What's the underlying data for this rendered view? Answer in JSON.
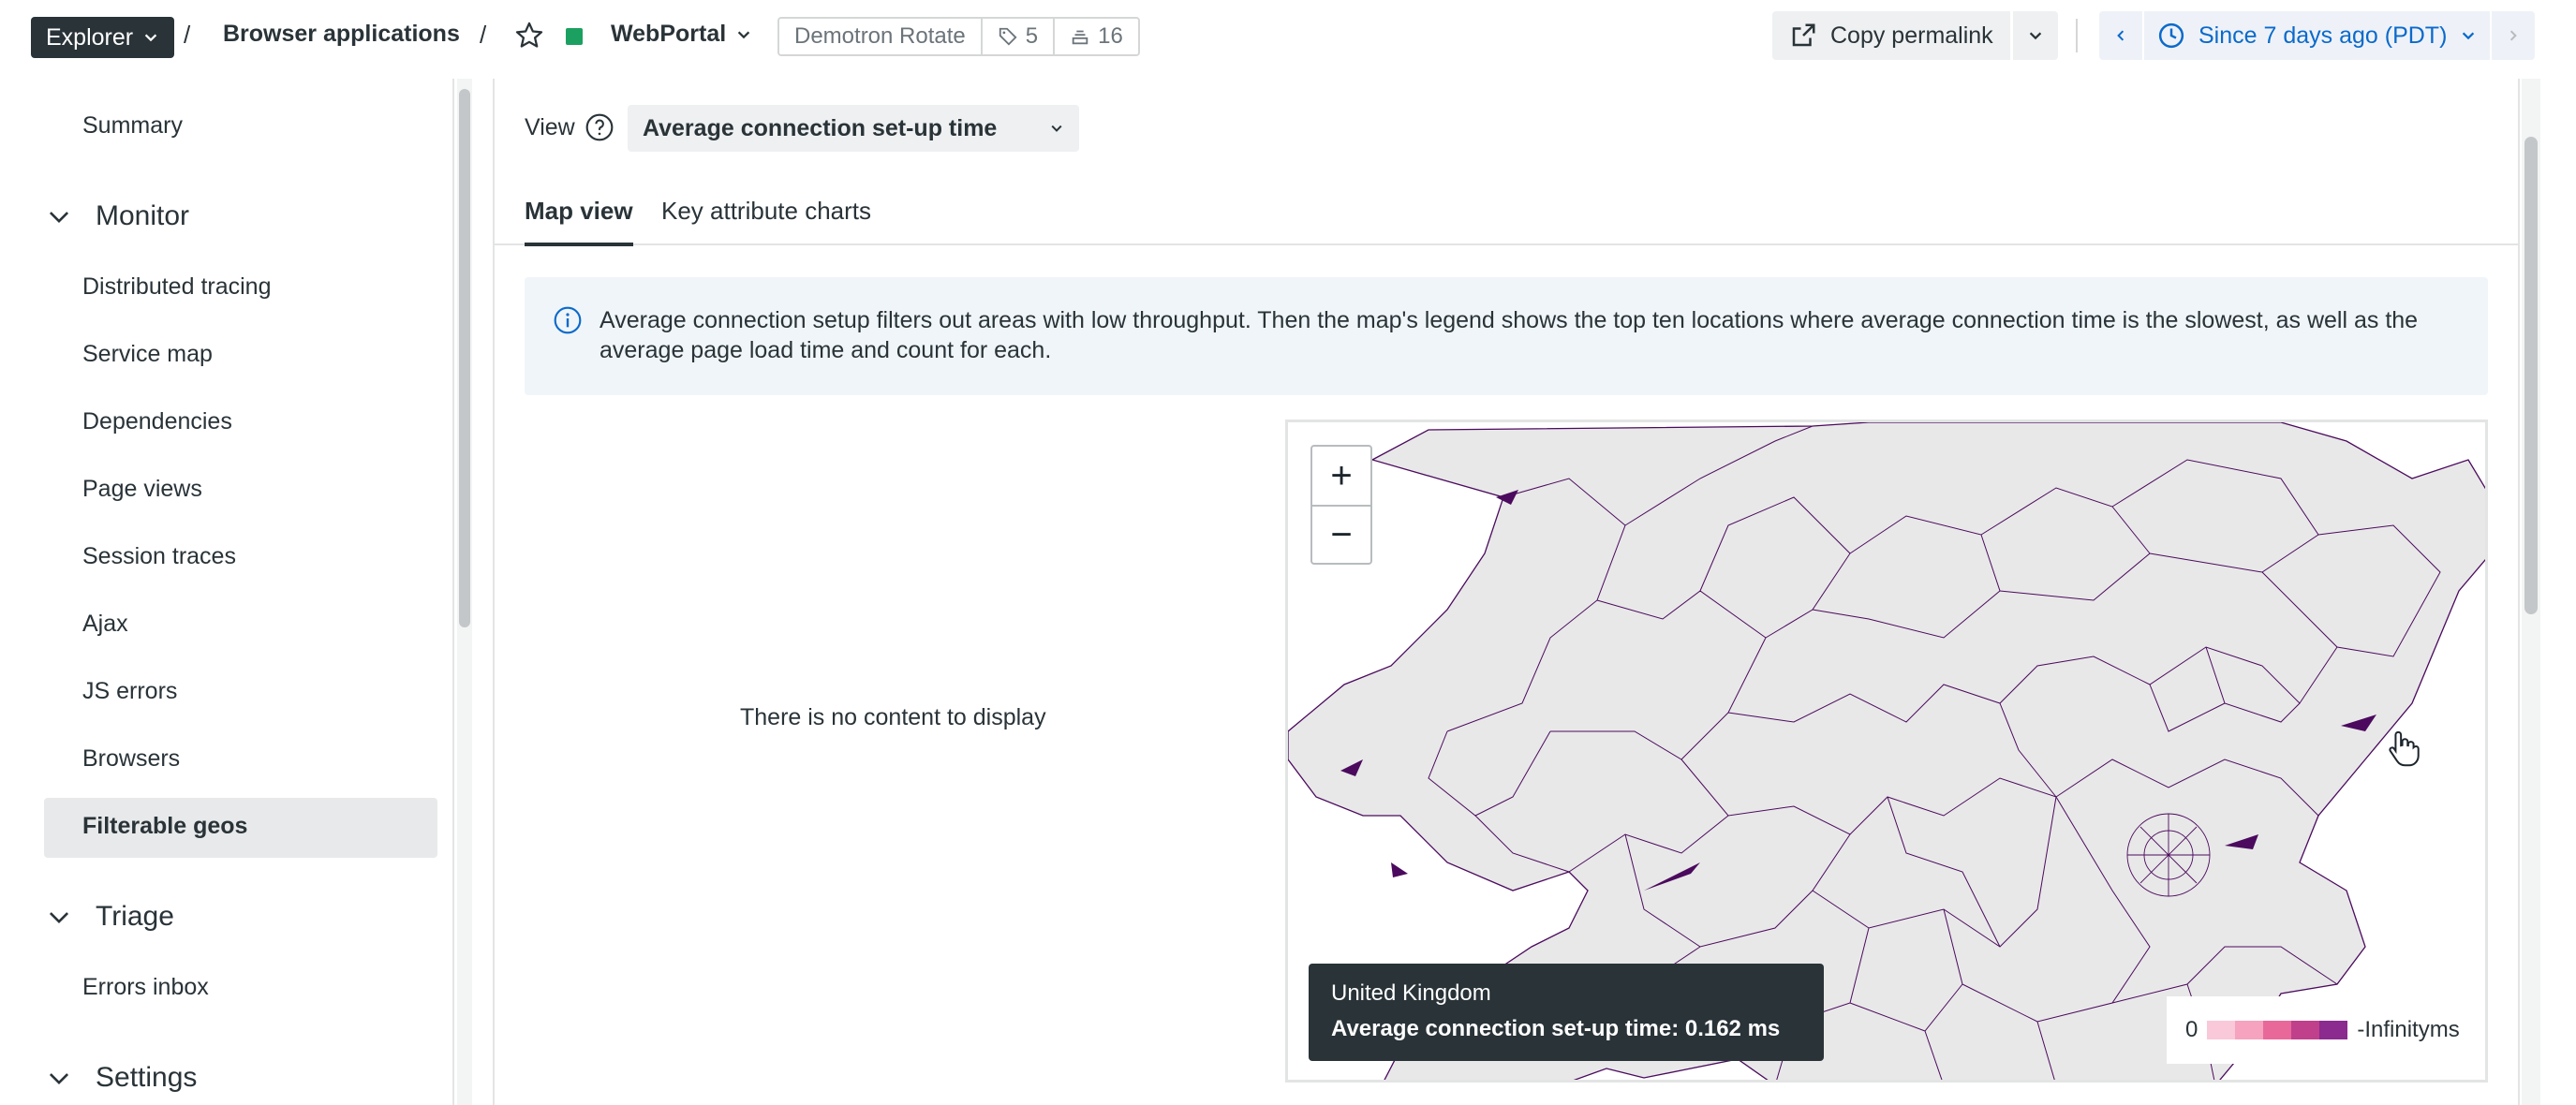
{
  "topbar": {
    "explorer_label": "Explorer",
    "breadcrumb": "Browser applications",
    "app_name": "WebPortal",
    "tag_name": "Demotron Rotate",
    "tags_count": "5",
    "entities_count": "16",
    "permalink_label": "Copy permalink",
    "time_range": "Since 7 days ago (PDT)",
    "status_color": "#1ca061",
    "accent_color": "#0b6acb"
  },
  "sidebar": {
    "items_top": [
      "Summary"
    ],
    "groups": [
      {
        "label": "Monitor",
        "items": [
          "Distributed tracing",
          "Service map",
          "Dependencies",
          "Page views",
          "Session traces",
          "Ajax",
          "JS errors",
          "Browsers",
          "Filterable geos"
        ]
      },
      {
        "label": "Triage",
        "items": [
          "Errors inbox"
        ]
      },
      {
        "label": "Settings",
        "items": []
      }
    ],
    "active_item": "Filterable geos"
  },
  "main": {
    "view_label": "View",
    "view_value": "Average connection set-up time",
    "tabs": [
      "Map view",
      "Key attribute charts"
    ],
    "active_tab": "Map view",
    "info_text": "Average connection setup filters out areas with low throughput. Then the map's legend shows the top ten locations where average connection time is the slowest, as well as the average page load time and count for each.",
    "empty_message": "There is no content to display"
  },
  "map": {
    "zoom_in": "+",
    "zoom_out": "−",
    "tooltip_region": "United Kingdom",
    "tooltip_metric": "Average connection set-up time: 0.162 ms",
    "legend_min": "0",
    "legend_max": "-Infinityms",
    "legend_colors": [
      "#f9c9d9",
      "#f5a3bf",
      "#e9689a",
      "#c0408c",
      "#8b2a8f"
    ],
    "region_fill": "#e8e8e8",
    "highlight_color": "#4b0a5e"
  }
}
